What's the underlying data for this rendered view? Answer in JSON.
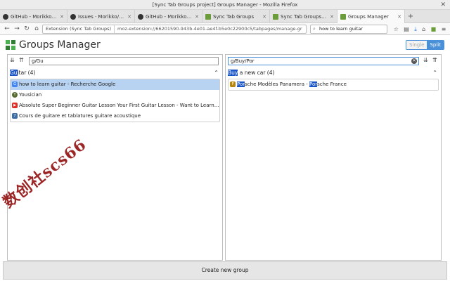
{
  "window": {
    "title": "[Sync Tab Groups project] Groups Manager - Mozilla Firefox",
    "close_glyph": "✕"
  },
  "tabs": [
    {
      "label": "GitHub - Morikko/sync-ta",
      "icon_color": "#333333",
      "icon": "github-icon"
    },
    {
      "label": "Issues · Morikko/sync-ta",
      "icon_color": "#333333",
      "icon": "github-icon"
    },
    {
      "label": "GitHub - Morikko/synctal",
      "icon_color": "#333333",
      "icon": "github-icon"
    },
    {
      "label": "Sync Tab Groups",
      "icon_color": "#6a9c3b",
      "icon": "puzzle-icon"
    },
    {
      "label": "Sync Tab Groups – Add-o",
      "icon_color": "#6a9c3b",
      "icon": "puzzle-icon"
    },
    {
      "label": "Groups Manager",
      "icon_color": "#6a9c3b",
      "icon": "puzzle-icon",
      "active": true
    }
  ],
  "tab_close_glyph": "✕",
  "new_tab_glyph": "+",
  "navbar": {
    "identity": "Extension (Sync Tab Groups)",
    "url": "moz-extension://66201590-943b-4e01-ae4f-b5e0c22900c5/tabpages/manage-gr",
    "search_value": "how to learn guitar"
  },
  "app": {
    "title": "Groups Manager",
    "mode_single": "Single",
    "mode_split": "Split",
    "create_group": "Create new group"
  },
  "left_panel": {
    "search_value": "g/Gu",
    "group_highlight": "Gu",
    "group_rest": "itar (4)",
    "tabs": [
      {
        "title": "how to learn guitar - Recherche Google",
        "fav": "G",
        "fav_color": "#4285f4",
        "selected": true
      },
      {
        "title": "Yousician",
        "fav": "Y",
        "fav_color": "#556b2f"
      },
      {
        "title": "Absolute Super Beginner Guitar Lesson Your First Guitar Lesson - Want to Learn ...",
        "fav": "▶",
        "fav_color": "#e52d27"
      },
      {
        "title": "Cours de guitare et tablatures guitare acoustique",
        "fav": "7",
        "fav_color": "#3b6ea5"
      }
    ]
  },
  "right_panel": {
    "search_value": "g/Buy/Por",
    "group_highlight": "Buy",
    "group_rest": " a new car (4)",
    "tabs": [
      {
        "hl1": "Por",
        "mid": "sche Modèles Panamera - ",
        "hl2": "Por",
        "end": "sche France",
        "fav": "P",
        "fav_color": "#b8860b"
      }
    ]
  },
  "watermark": "数创社scs66"
}
